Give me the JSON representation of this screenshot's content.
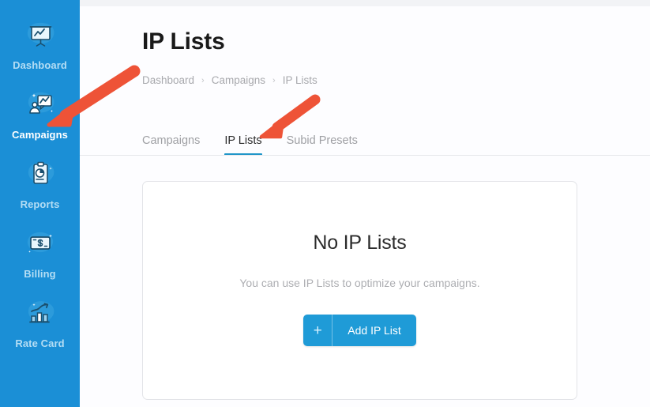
{
  "sidebar": {
    "background_color": "#1b8fd6",
    "items": [
      {
        "label": "Dashboard",
        "icon": "presentation-chart-icon",
        "active": false
      },
      {
        "label": "Campaigns",
        "icon": "campaign-megaphone-chart-icon",
        "active": true
      },
      {
        "label": "Reports",
        "icon": "clipboard-pie-chart-icon",
        "active": false
      },
      {
        "label": "Billing",
        "icon": "banknote-dollar-icon",
        "active": false
      },
      {
        "label": "Rate Card",
        "icon": "bar-chart-arrow-icon",
        "active": false
      }
    ]
  },
  "header": {
    "title": "IP Lists"
  },
  "breadcrumb": {
    "separator": "›",
    "items": [
      {
        "label": "Dashboard",
        "current": false
      },
      {
        "label": "Campaigns",
        "current": false
      },
      {
        "label": "IP Lists",
        "current": true
      }
    ]
  },
  "tabs": {
    "accent_color": "#2196c9",
    "items": [
      {
        "label": "Campaigns",
        "active": false
      },
      {
        "label": "IP Lists",
        "active": true
      },
      {
        "label": "Subid Presets",
        "active": false
      }
    ]
  },
  "empty_state": {
    "title": "No IP Lists",
    "subtitle": "You can use IP Lists to optimize your campaigns.",
    "button": {
      "icon": "plus-icon",
      "icon_glyph": "+",
      "label": "Add IP List",
      "color": "#1f9bd7"
    }
  },
  "annotations": {
    "color": "#ee5337",
    "arrows": [
      {
        "name": "arrow-to-campaigns-nav",
        "points_to": "Campaigns"
      },
      {
        "name": "arrow-to-ip-lists-tab",
        "points_to": "IP Lists"
      }
    ]
  }
}
